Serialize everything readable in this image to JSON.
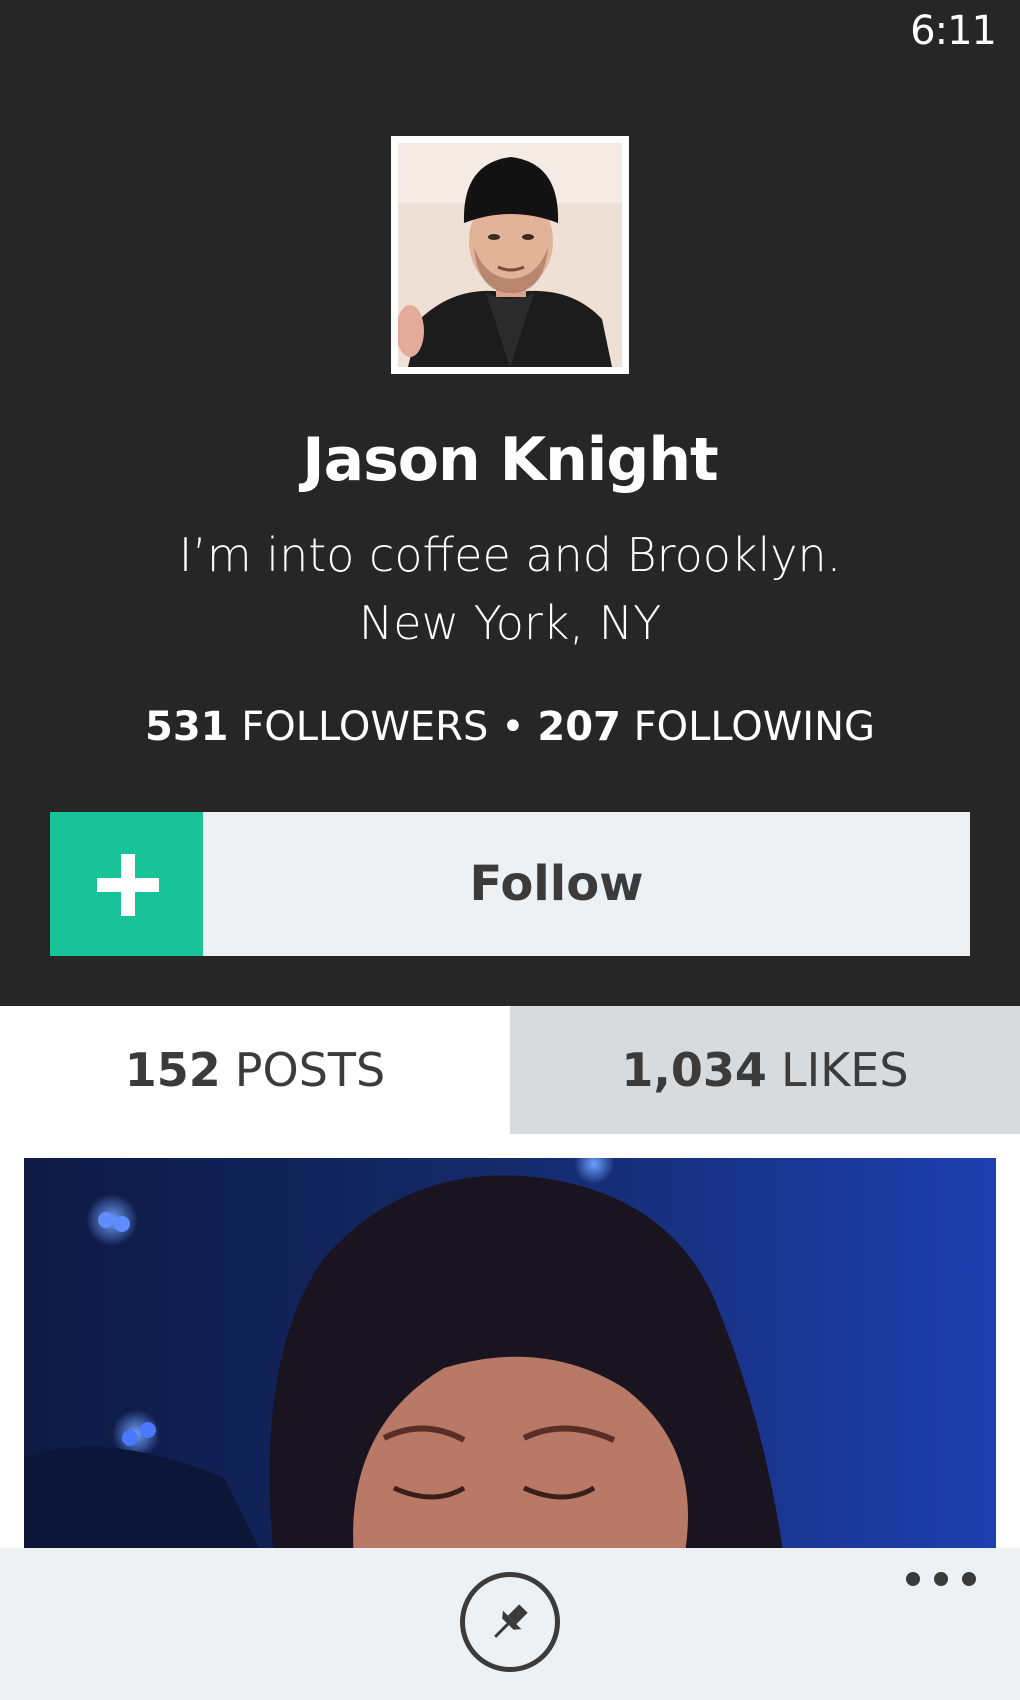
{
  "status_bar": {
    "time": "6:11"
  },
  "profile": {
    "name": "Jason Knight",
    "bio": "I’m into coffee and Brooklyn.",
    "location": "New York, NY",
    "followers_count": "531",
    "followers_label": "FOLLOWERS",
    "separator": "•",
    "following_count": "207",
    "following_label": "FOLLOWING",
    "avatar_icon": "user-photo"
  },
  "follow_button": {
    "label": "Follow",
    "icon": "plus-icon",
    "accent_color": "#19c39a"
  },
  "tabs": [
    {
      "count": "152",
      "label": "POSTS",
      "selected": true
    },
    {
      "count": "1,034",
      "label": "LIKES",
      "selected": false
    }
  ],
  "app_bar": {
    "pin_icon": "pin-icon",
    "more_icon": "more-icon"
  },
  "colors": {
    "header_bg": "#262626",
    "app_bar_bg": "#eef1f4",
    "tab_inactive_bg": "#d8dbde"
  }
}
